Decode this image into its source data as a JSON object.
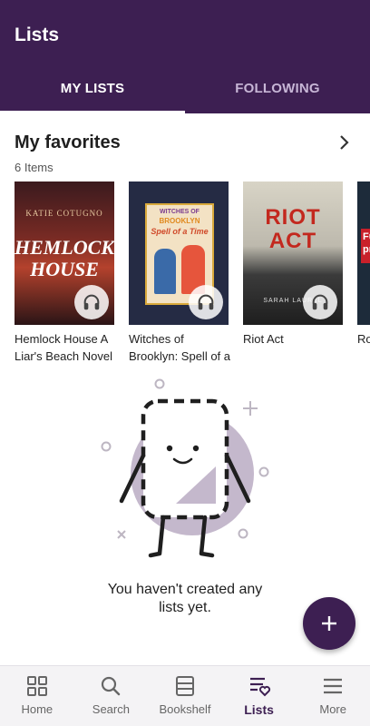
{
  "header": {
    "title": "Lists",
    "tabs": [
      {
        "label": "MY LISTS",
        "active": true
      },
      {
        "label": "FOLLOWING",
        "active": false
      }
    ],
    "background_color": "#3d1f52"
  },
  "favorites": {
    "title": "My favorites",
    "count": "6 Items",
    "books": [
      {
        "title": "Hemlock House A Liar's Beach Novel",
        "cover_author": "KATIE COTUGNO",
        "cover_title_line1": "HEMLOCK",
        "cover_title_line2": "HOUSE",
        "audiobook": true
      },
      {
        "title": "Witches of Brooklyn: Spell of a Time",
        "cover_title_line1": "WITCHES OF",
        "cover_title_line2": "BROOKLYN",
        "cover_title_line3": "Spell of a Time",
        "audiobook": true
      },
      {
        "title": "Riot Act",
        "cover_title_line1": "RIOT",
        "cover_title_line2": "ACT",
        "cover_author": "SARAH LAUREL",
        "audiobook": true
      },
      {
        "title": "Ro - F",
        "cover_title_line1": "Fu",
        "cover_title_line2": "pre",
        "audiobook": false
      }
    ]
  },
  "empty_state": {
    "message_line1": "You haven't created any",
    "message_line2": "lists yet."
  },
  "fab": {
    "icon": "plus-icon",
    "accent": "#3d1f52"
  },
  "bottom_nav": [
    {
      "label": "Home",
      "icon": "home-grid-icon",
      "active": false
    },
    {
      "label": "Search",
      "icon": "search-icon",
      "active": false
    },
    {
      "label": "Bookshelf",
      "icon": "bookshelf-icon",
      "active": false
    },
    {
      "label": "Lists",
      "icon": "lists-heart-icon",
      "active": true
    },
    {
      "label": "More",
      "icon": "menu-icon",
      "active": false
    }
  ]
}
